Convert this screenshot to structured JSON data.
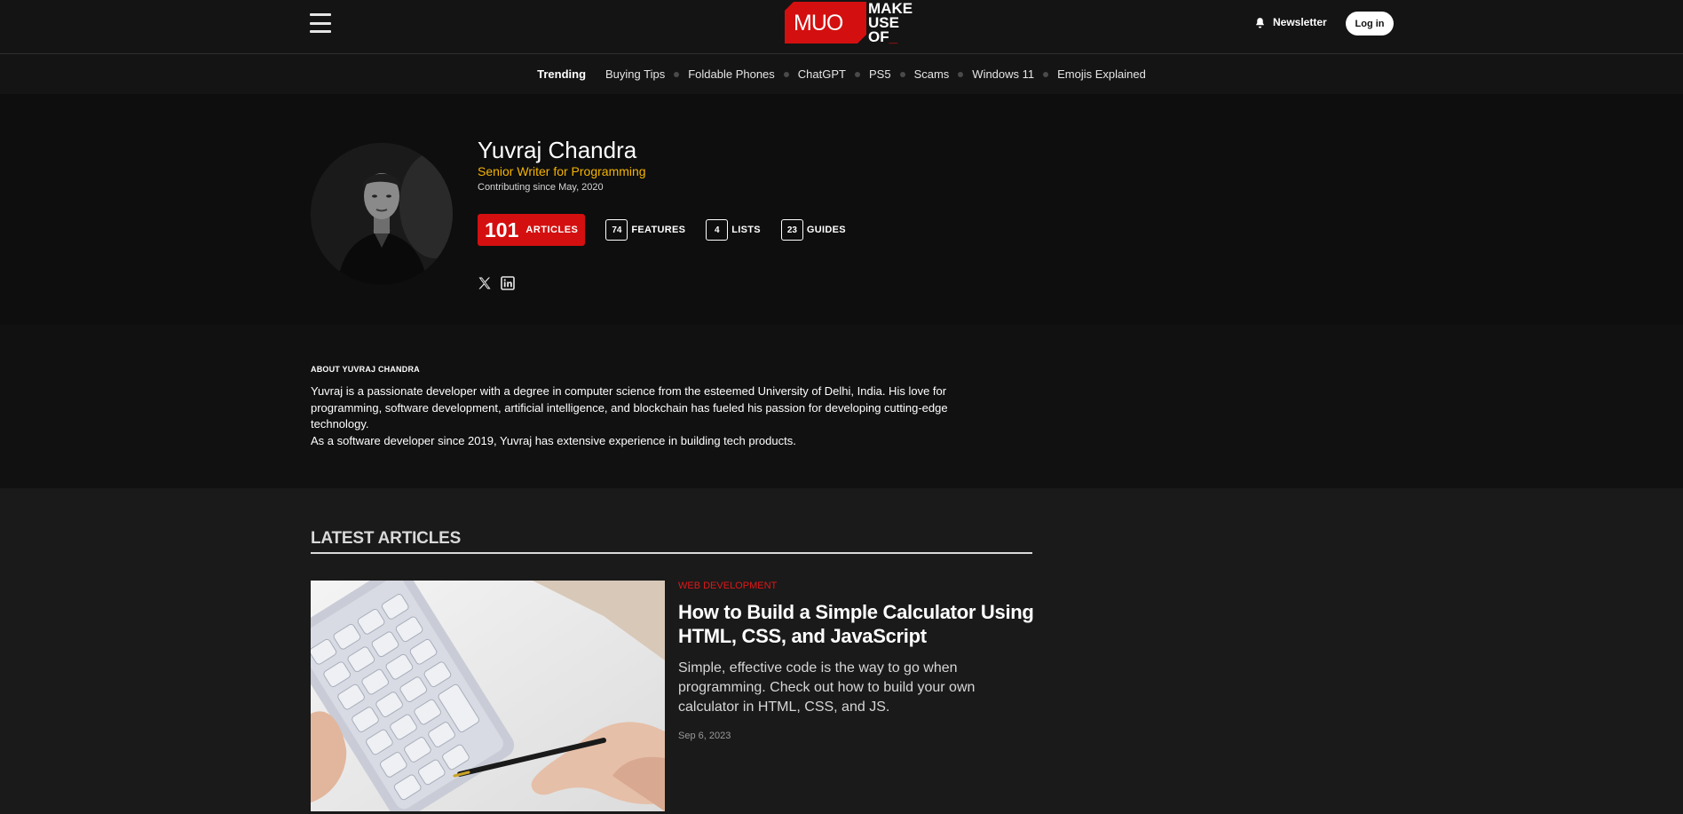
{
  "header": {
    "logo_letters": "MUO",
    "logo_words": [
      "MAKE",
      "USE",
      "OF"
    ],
    "newsletter_label": "Newsletter",
    "login_label": "Log in"
  },
  "trending": {
    "label": "Trending",
    "items": [
      "Buying Tips",
      "Foldable Phones",
      "ChatGPT",
      "PS5",
      "Scams",
      "Windows 11",
      "Emojis Explained"
    ]
  },
  "author": {
    "name": "Yuvraj Chandra",
    "role": "Senior Writer for Programming",
    "since": "Contributing since May, 2020",
    "stats": {
      "articles": {
        "count": "101",
        "label": "ARTICLES"
      },
      "features": {
        "count": "74",
        "label": "FEATURES"
      },
      "lists": {
        "count": "4",
        "label": "LISTS"
      },
      "guides": {
        "count": "23",
        "label": "GUIDES"
      }
    }
  },
  "about": {
    "title": "ABOUT YUVRAJ CHANDRA",
    "paragraph1": "Yuvraj is a passionate developer with a degree in computer science from the esteemed University of Delhi, India. His love for programming, software development, artificial intelligence, and blockchain has fueled his passion for developing cutting-edge technology.",
    "paragraph2": "As a software developer since 2019, Yuvraj has extensive experience in building tech products."
  },
  "latest": {
    "title": "LATEST ARTICLES",
    "article": {
      "category": "WEB DEVELOPMENT",
      "title": "How to Build a Simple Calculator Using HTML, CSS, and JavaScript",
      "excerpt": "Simple, effective code is the way to go when programming. Check out how to build your own calculator in HTML, CSS, and JS.",
      "date": "Sep 6, 2023"
    }
  },
  "colors": {
    "brand_red": "#d40f0f",
    "role_yellow": "#f5b400",
    "category_red": "#e01818"
  }
}
